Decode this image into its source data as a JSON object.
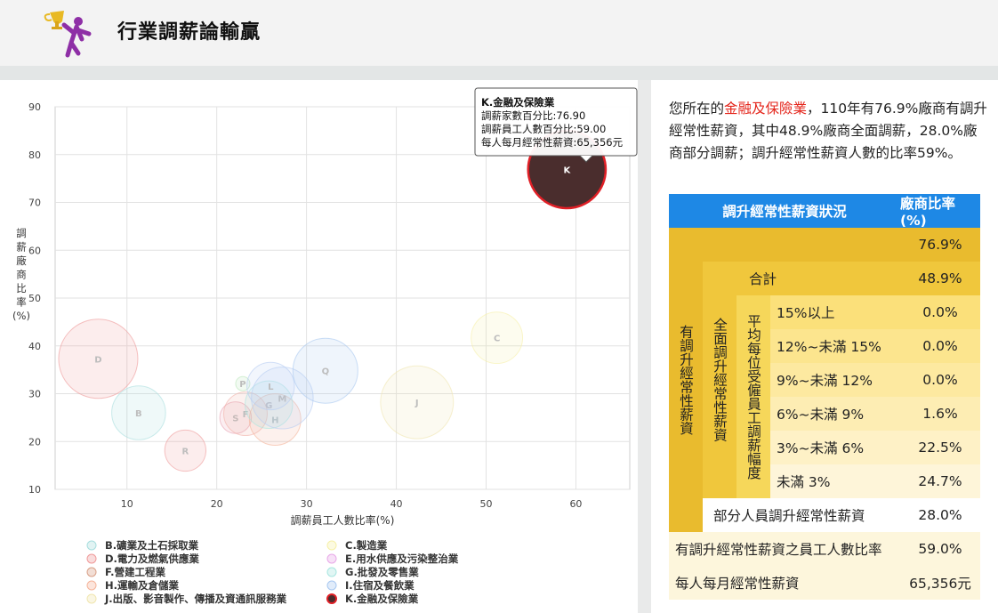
{
  "header": {
    "title": "行業調薪論輸贏",
    "logo_icon": "trophy-runner-icon"
  },
  "chart_data": {
    "type": "scatter",
    "title": "",
    "xlabel": "調薪員工人數比率(%)",
    "ylabel": "調薪廠商比率(%)",
    "xlim": [
      2,
      66
    ],
    "ylim": [
      10,
      90
    ],
    "xticks": [
      10,
      20,
      30,
      40,
      50,
      60
    ],
    "yticks": [
      10,
      20,
      30,
      40,
      50,
      60,
      70,
      80,
      90
    ],
    "grid": true,
    "legend_position": "bottom",
    "points": [
      {
        "label": "D",
        "x": 6.8,
        "y": 37.3,
        "size": 100,
        "color": "#ef9a9a",
        "active": false
      },
      {
        "label": "B",
        "x": 11.3,
        "y": 26.0,
        "size": 68,
        "color": "#a8dede",
        "active": false
      },
      {
        "label": "R",
        "x": 16.5,
        "y": 18.1,
        "size": 52,
        "color": "#ef9a9a",
        "active": false
      },
      {
        "label": "S",
        "x": 22.1,
        "y": 25.0,
        "size": 40,
        "color": "#e8a0b0",
        "active": false
      },
      {
        "label": "F",
        "x": 23.2,
        "y": 25.8,
        "size": 55,
        "color": "#f1b0a8",
        "active": false
      },
      {
        "label": "P",
        "x": 22.9,
        "y": 32.1,
        "size": 18,
        "color": "#b9e6b9",
        "active": false
      },
      {
        "label": "H",
        "x": 26.5,
        "y": 24.6,
        "size": 65,
        "color": "#f5b49a",
        "active": false
      },
      {
        "label": "G",
        "x": 25.8,
        "y": 27.7,
        "size": 60,
        "color": "#a8e6e0",
        "active": false
      },
      {
        "label": "M",
        "x": 27.3,
        "y": 29.1,
        "size": 78,
        "color": "#b6ccf2",
        "active": false
      },
      {
        "label": "L",
        "x": 26.0,
        "y": 31.6,
        "size": 60,
        "color": "#b6ccf2",
        "active": false
      },
      {
        "label": "Q",
        "x": 32.1,
        "y": 34.8,
        "size": 82,
        "color": "#a8c8f0",
        "active": false
      },
      {
        "label": "J",
        "x": 42.3,
        "y": 28.2,
        "size": 92,
        "color": "#f0e6b0",
        "active": false
      },
      {
        "label": "C",
        "x": 51.2,
        "y": 41.7,
        "size": 65,
        "color": "#f6f0a8",
        "active": false
      },
      {
        "label": "K",
        "x": 59.0,
        "y": 76.9,
        "size": 98,
        "color": "#4a2d2d",
        "active": true
      }
    ],
    "tooltip": {
      "title": "K.金融及保險業",
      "line1": "調薪家數百分比:76.90",
      "line2": "調薪員工人數百分比:59.00",
      "line3": "每人每月經常性薪資:65,356元"
    },
    "legend": [
      {
        "code": "B",
        "name": "B.礦業及土石採取業",
        "color": "#a8dede"
      },
      {
        "code": "C",
        "name": "C.製造業",
        "color": "#f6f0a8"
      },
      {
        "code": "D",
        "name": "D.電力及燃氣供應業",
        "color": "#ef9a9a"
      },
      {
        "code": "E",
        "name": "E.用水供應及污染整治業",
        "color": "#e8a8e8"
      },
      {
        "code": "F",
        "name": "F.營建工程業",
        "color": "#d9a088"
      },
      {
        "code": "G",
        "name": "G.批發及零售業",
        "color": "#a8e6e0"
      },
      {
        "code": "H",
        "name": "H.運輸及倉儲業",
        "color": "#f5b49a"
      },
      {
        "code": "I",
        "name": "I.住宿及餐飲業",
        "color": "#a8c8f0"
      },
      {
        "code": "J",
        "name": "J.出版、影音製作、傳播及資通訊服務業",
        "color": "#f0e6b0"
      },
      {
        "code": "K",
        "name": "K.金融及保險業",
        "color": "#4a2d2d"
      }
    ]
  },
  "summary": {
    "pre": "您所在的",
    "industry": "金融及保險業",
    "post": "，110年有76.9%廠商有調升經常性薪資，其中48.9%廠商全面調薪，28.0%廠商部分調薪；調升經常性薪資人數的比率59%。"
  },
  "table": {
    "header_col1": "調升經常性薪資狀況",
    "header_col2": "廠商比率(%)",
    "vert_l1": "有調升經常性薪資",
    "vert_l2": "全面調升經常性薪資",
    "vert_l3": "平均每位受僱員工調薪幅度",
    "total_value": "76.9%",
    "subtotal_label": "合計",
    "subtotal_value": "48.9%",
    "rows": [
      {
        "label": "15%以上",
        "value": "0.0%"
      },
      {
        "label": "12%~未滿 15%",
        "value": "0.0%"
      },
      {
        "label": "9%~未滿 12%",
        "value": "0.0%"
      },
      {
        "label": "6%~未滿 9%",
        "value": "1.6%"
      },
      {
        "label": "3%~未滿 6%",
        "value": "22.5%"
      },
      {
        "label": "未滿 3%",
        "value": "24.7%"
      }
    ],
    "partial_label": "部分人員調升經常性薪資",
    "partial_value": "28.0%",
    "ratio_label": "有調升經常性薪資之員工人數比率",
    "ratio_value": "59.0%",
    "salary_label": "每人每月經常性薪資",
    "salary_value": "65,356元"
  },
  "colors": {
    "table_header": "#1e88e5",
    "l1": "#e9bb2e",
    "l2": "#f0c73c",
    "l3": "#f6d75a",
    "row_shades": [
      "#fbe07a",
      "#fce58e",
      "#fde9a0",
      "#fdedb3",
      "#fef1c6",
      "#fef5d9"
    ],
    "partial_bg": "#ffffff",
    "bottom_bg": "#fdf6dc"
  }
}
